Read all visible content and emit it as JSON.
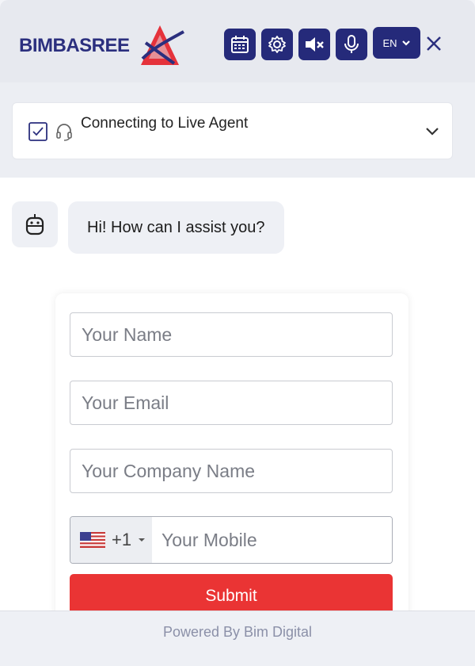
{
  "header": {
    "brand": "BIMBASREE",
    "language": "EN",
    "icons": [
      "calendar-icon",
      "gear-icon",
      "mute-icon",
      "microphone-icon",
      "chevron-down-icon",
      "close-icon"
    ],
    "colors": {
      "button_bg": "#252a7a",
      "brand_red": "#e5323b",
      "header_bg": "#e7e9ef"
    }
  },
  "agent": {
    "title": "Connecting to Live Agent"
  },
  "chat": {
    "greeting": "Hi! How can I assist you?"
  },
  "form": {
    "name_placeholder": "Your Name",
    "email_placeholder": "Your Email",
    "company_placeholder": "Your Company Name",
    "country_code": "+1",
    "mobile_placeholder": "Your Mobile",
    "submit_label": "Submit",
    "submit_color": "#ea3434"
  },
  "footer": {
    "powered_by": "Powered By Bim Digital"
  }
}
